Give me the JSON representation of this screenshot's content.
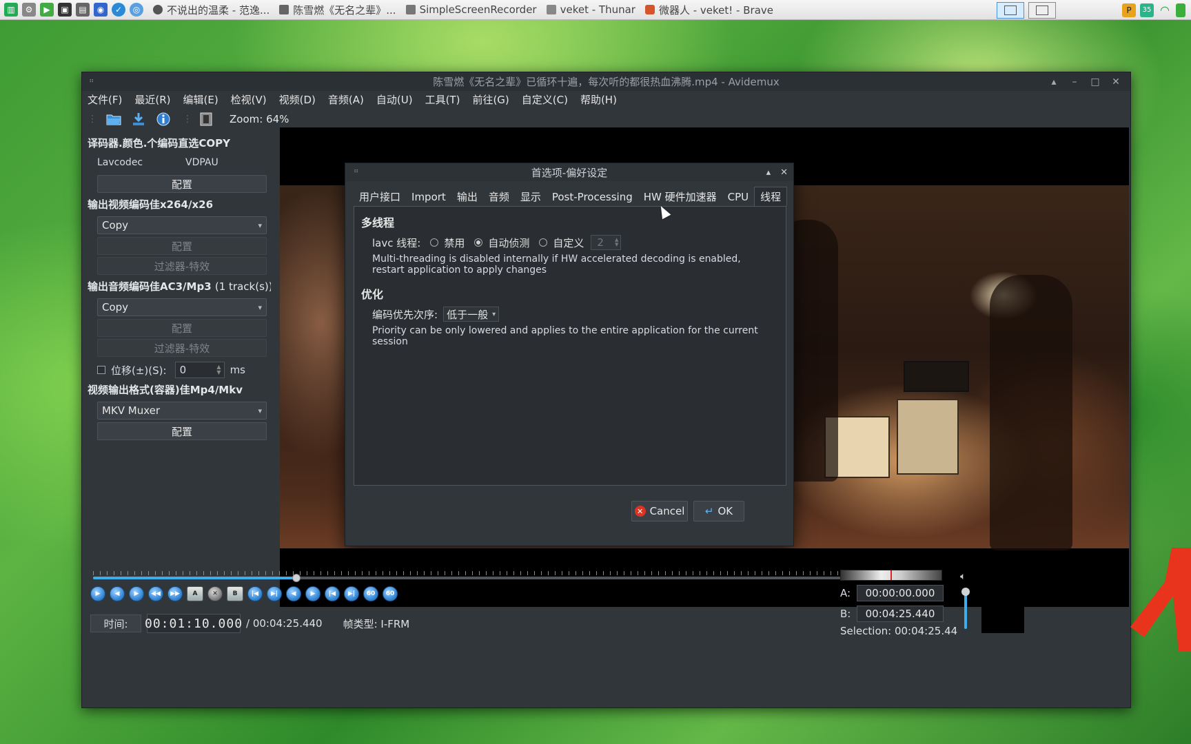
{
  "taskbar": {
    "tasks": [
      {
        "label": "不说出的温柔 - 范逸..."
      },
      {
        "label": "陈雪燃《无名之辈》..."
      },
      {
        "label": "SimpleScreenRecorder"
      },
      {
        "label": "veket - Thunar"
      },
      {
        "label": "微器人 - veket! - Brave"
      }
    ],
    "tray": {
      "temp": "35"
    }
  },
  "window": {
    "title": "陈雪燃《无名之辈》已循环十遍，每次听的都很热血沸腾.mp4 - Avidemux",
    "menu": [
      "文件(F)",
      "最近(R)",
      "编辑(E)",
      "检视(V)",
      "视频(D)",
      "音频(A)",
      "自动(U)",
      "工具(T)",
      "前往(G)",
      "自定义(C)",
      "帮助(H)"
    ],
    "zoom": "Zoom: 64%"
  },
  "left": {
    "decoder_title": "译码器.颜色.个编码直选COPY",
    "decoder_lib": "Lavcodec",
    "decoder_hw": "VDPAU",
    "configure": "配置",
    "video_title": "输出视频编码佳x264/x26",
    "video_codec": "Copy",
    "filters": "过滤器-特效",
    "audio_title": "输出音频编码佳AC3/Mp3",
    "audio_tracks": "(1 track(s))",
    "audio_codec": "Copy",
    "offset_label": "位移(±)(S):",
    "offset_value": "0",
    "offset_unit": "ms",
    "muxer_title": "视频输出格式(容器)佳Mp4/Mkv",
    "muxer": "MKV Muxer"
  },
  "dialog": {
    "title": "首选项-偏好设定",
    "tabs": [
      "用户接口",
      "Import",
      "输出",
      "音频",
      "显示",
      "Post-Processing",
      "HW 硬件加速器",
      "CPU",
      "线程"
    ],
    "multithread_group": "多线程",
    "lavc_label": "lavc 线程:",
    "opt_disable": "禁用",
    "opt_auto": "自动侦测",
    "opt_custom": "自定义",
    "custom_value": "2",
    "mt_note": "Multi-threading is disabled internally if HW accelerated decoding is enabled, restart application to apply changes",
    "optimize_group": "优化",
    "priority_label": "编码优先次序:",
    "priority_value": "低于一般",
    "priority_note": "Priority can be only lowered and applies to the entire application for the current session",
    "cancel": "Cancel",
    "ok": "OK"
  },
  "player": {
    "time_label": "时间:",
    "current_time": "00:01:10.000",
    "total_time": "/ 00:04:25.440",
    "frame_type": "帧类型: I-FRM",
    "progress": 0.25,
    "a_label": "A:",
    "a_time": "00:00:00.000",
    "b_label": "B:",
    "b_time": "00:04:25.440",
    "selection": "Selection: 00:04:25.44"
  }
}
